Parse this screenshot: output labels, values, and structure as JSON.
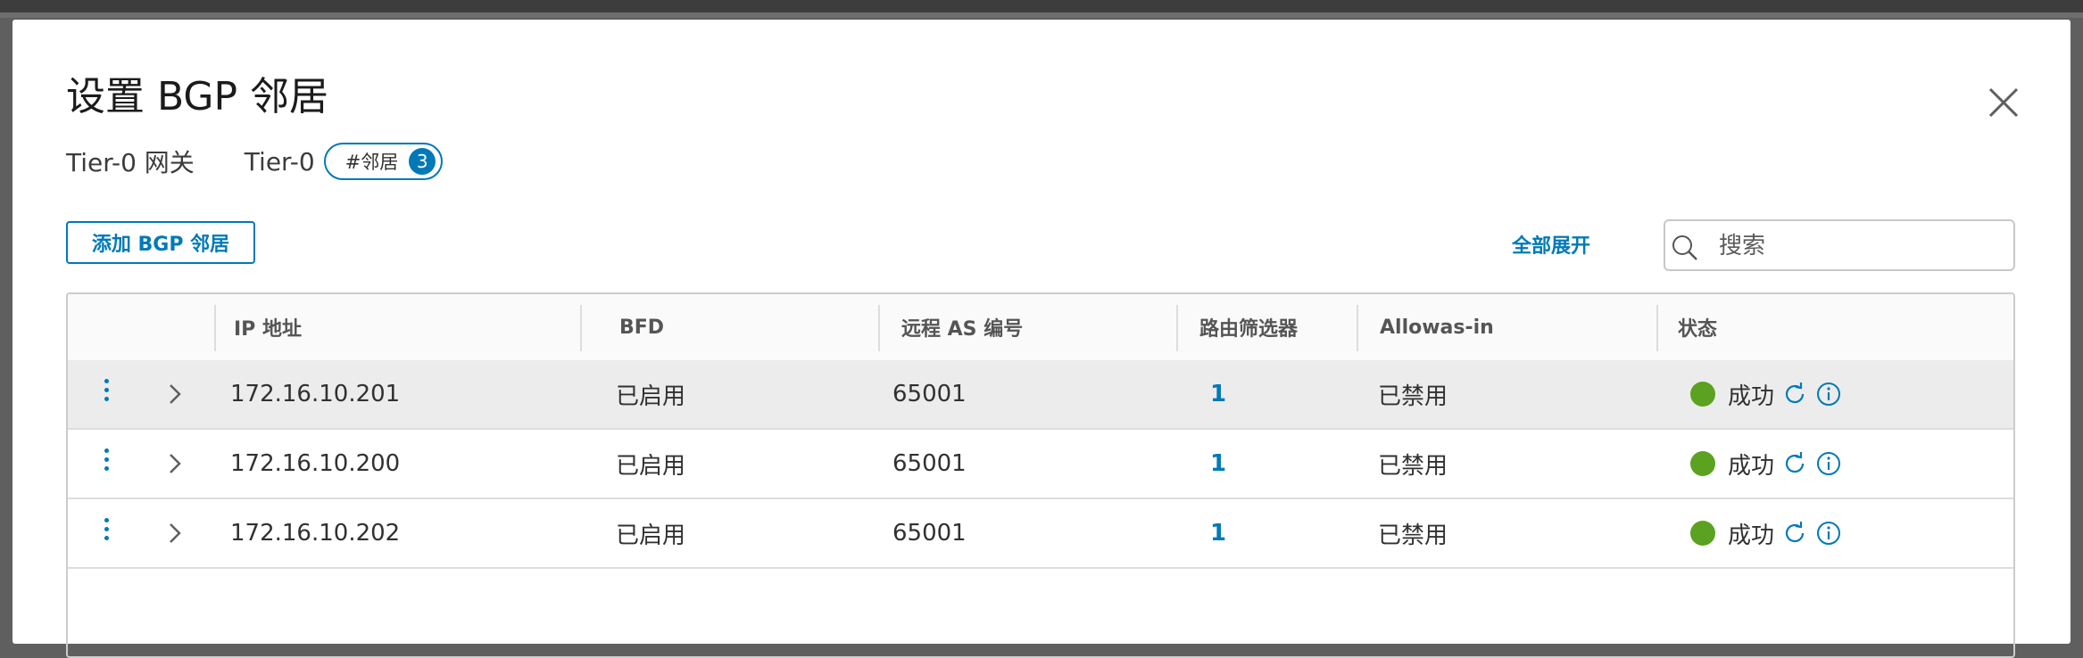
{
  "dialog": {
    "title": "设置 BGP 邻居",
    "subtitle_gateway": "Tier-0 网关",
    "subtitle_tier": "Tier-0",
    "pill_label": "#邻居",
    "pill_count": "3"
  },
  "toolbar": {
    "add_label": "添加 BGP 邻居",
    "expand_all_label": "全部展开",
    "search_placeholder": "搜索"
  },
  "table": {
    "headers": {
      "ip": "IP 地址",
      "bfd": "BFD",
      "remote_as": "远程 AS 编号",
      "route_filter": "路由筛选器",
      "allowas": "Allowas-in",
      "status": "状态"
    },
    "rows": [
      {
        "ip": "172.16.10.201",
        "bfd": "已启用",
        "remote_as": "65001",
        "route_filter": "1",
        "allowas": "已禁用",
        "status": "成功"
      },
      {
        "ip": "172.16.10.200",
        "bfd": "已启用",
        "remote_as": "65001",
        "route_filter": "1",
        "allowas": "已禁用",
        "status": "成功"
      },
      {
        "ip": "172.16.10.202",
        "bfd": "已启用",
        "remote_as": "65001",
        "route_filter": "1",
        "allowas": "已禁用",
        "status": "成功"
      }
    ]
  },
  "icons": {
    "close": "close-icon",
    "search": "search-icon",
    "row_actions": "vertical-ellipsis-icon",
    "expand_row": "chevron-right-icon",
    "status_ok": "status-success-dot",
    "refresh": "refresh-icon",
    "info": "info-icon"
  },
  "colors": {
    "accent": "#0079b8",
    "success": "#5aa220",
    "selected_row": "#ececec"
  }
}
